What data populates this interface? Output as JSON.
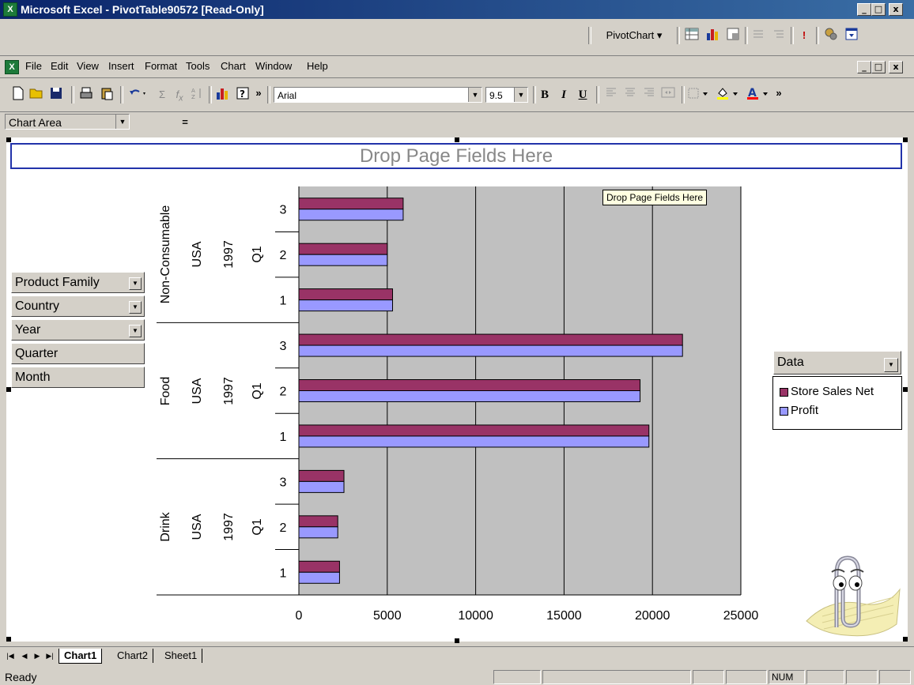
{
  "window": {
    "title": "Microsoft Excel - PivotTable90572  [Read-Only]",
    "min": "_",
    "max": "□",
    "close": "x"
  },
  "pivot_toolbar": {
    "pivotchart_label": "PivotChart ▾",
    "exclaim": "!"
  },
  "menu": {
    "items": [
      "File",
      "Edit",
      "View",
      "Insert",
      "Format",
      "Tools",
      "Chart",
      "Window",
      "Help"
    ]
  },
  "format_toolbar": {
    "font": "Arial",
    "size": "9.5",
    "bold": "B",
    "italic": "I",
    "underline": "U",
    "more": "»"
  },
  "name_box": {
    "value": "Chart Area",
    "equals": "="
  },
  "chart": {
    "page_drop_label": "Drop Page Fields Here",
    "tooltip": "Drop Page Fields Here",
    "row_fields": [
      "Product Family",
      "Country",
      "Year",
      "Quarter",
      "Month"
    ],
    "data_field": "Data",
    "legend": [
      {
        "name": "Store Sales Net",
        "color": "#993366"
      },
      {
        "name": "Profit",
        "color": "#9999ff"
      }
    ],
    "groups": [
      {
        "family": "Non-Consumable",
        "country": "USA",
        "year": "1997",
        "quarter": "Q1"
      },
      {
        "family": "Food",
        "country": "USA",
        "year": "1997",
        "quarter": "Q1"
      },
      {
        "family": "Drink",
        "country": "USA",
        "year": "1997",
        "quarter": "Q1"
      }
    ]
  },
  "chart_data": {
    "type": "bar",
    "orientation": "horizontal",
    "categories": [
      "Non-Consumable|USA|1997|Q1|3",
      "Non-Consumable|USA|1997|Q1|2",
      "Non-Consumable|USA|1997|Q1|1",
      "Food|USA|1997|Q1|3",
      "Food|USA|1997|Q1|2",
      "Food|USA|1997|Q1|1",
      "Drink|USA|1997|Q1|3",
      "Drink|USA|1997|Q1|2",
      "Drink|USA|1997|Q1|1"
    ],
    "month_labels": [
      "3",
      "2",
      "1",
      "3",
      "2",
      "1",
      "3",
      "2",
      "1"
    ],
    "series": [
      {
        "name": "Store Sales Net",
        "values": [
          5900,
          5000,
          5300,
          21700,
          19300,
          19800,
          2550,
          2200,
          2300
        ]
      },
      {
        "name": "Profit",
        "values": [
          5900,
          5000,
          5300,
          21700,
          19300,
          19800,
          2550,
          2200,
          2300
        ]
      }
    ],
    "xlim": [
      0,
      25000
    ],
    "x_ticks": [
      "0",
      "5000",
      "10000",
      "15000",
      "20000",
      "25000"
    ],
    "grid": true,
    "legend_position": "right",
    "colors": {
      "series1": "#993366",
      "series2": "#9999ff",
      "plot_bg": "#c0c0c0"
    }
  },
  "sheet_tabs": [
    "Chart1",
    "Chart2",
    "Sheet1"
  ],
  "status": {
    "text": "Ready",
    "num": "NUM"
  }
}
